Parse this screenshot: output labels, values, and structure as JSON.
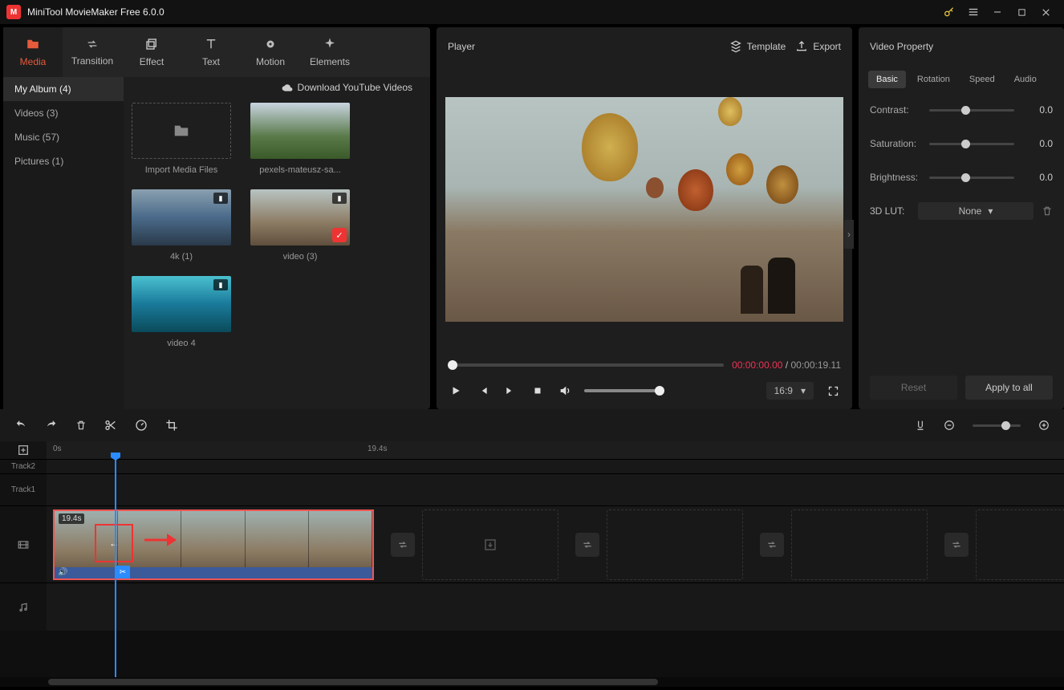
{
  "app": {
    "title": "MiniTool MovieMaker Free 6.0.0"
  },
  "ribbon": {
    "tabs": [
      {
        "label": "Media",
        "icon": "folder"
      },
      {
        "label": "Transition",
        "icon": "swap"
      },
      {
        "label": "Effect",
        "icon": "layers"
      },
      {
        "label": "Text",
        "icon": "text"
      },
      {
        "label": "Motion",
        "icon": "motion"
      },
      {
        "label": "Elements",
        "icon": "sparkle"
      }
    ]
  },
  "sidebar": {
    "items": [
      {
        "label": "My Album (4)"
      },
      {
        "label": "Videos (3)"
      },
      {
        "label": "Music (57)"
      },
      {
        "label": "Pictures (1)"
      }
    ]
  },
  "ytlink": "Download YouTube Videos",
  "media": {
    "import": "Import Media Files",
    "items": [
      {
        "label": "pexels-mateusz-sa...",
        "type": "image"
      },
      {
        "label": "4k (1)",
        "type": "video"
      },
      {
        "label": "video (3)",
        "type": "video",
        "checked": true
      },
      {
        "label": "video 4",
        "type": "video"
      }
    ]
  },
  "player": {
    "title": "Player",
    "template": "Template",
    "export": "Export",
    "current": "00:00:00.00",
    "sep": " / ",
    "total": "00:00:19.11",
    "ratio": "16:9"
  },
  "props": {
    "title": "Video Property",
    "tabs": [
      "Basic",
      "Rotation",
      "Speed",
      "Audio"
    ],
    "contrast_label": "Contrast:",
    "contrast_value": "0.0",
    "saturation_label": "Saturation:",
    "saturation_value": "0.0",
    "brightness_label": "Brightness:",
    "brightness_value": "0.0",
    "lut_label": "3D LUT:",
    "lut_value": "None",
    "reset": "Reset",
    "apply": "Apply to all"
  },
  "timeline": {
    "ticks": [
      "0s",
      "19.4s"
    ],
    "tracks": {
      "t2": "Track2",
      "t1": "Track1"
    },
    "clip_duration": "19.4s"
  }
}
